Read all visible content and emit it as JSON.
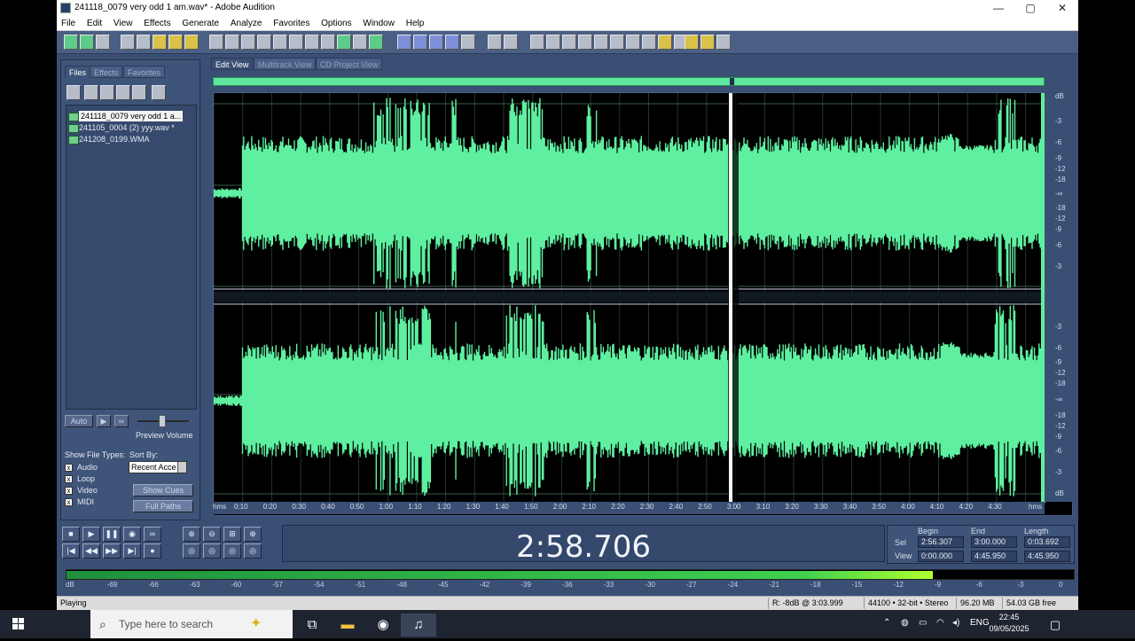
{
  "window": {
    "title": "241118_0079 very odd 1 am.wav* - Adobe Audition",
    "minimize": "—",
    "maximize": "▢",
    "close": "✕"
  },
  "menu": [
    "File",
    "Edit",
    "View",
    "Effects",
    "Generate",
    "Analyze",
    "Favorites",
    "Options",
    "Window",
    "Help"
  ],
  "left_panel": {
    "tabs": [
      "Files",
      "Effects",
      "Favorites"
    ],
    "files": [
      "241118_0079 very odd 1 a...",
      "241105_0004 (2) yyy.wav *",
      "241208_0199.WMA"
    ],
    "auto_label": "Auto",
    "play_label": "▶",
    "loop_label": "∞",
    "preview_volume": "Preview Volume",
    "show_file_types": "Show File Types:",
    "sort_by": "Sort By:",
    "sort_value": "Recent Acce",
    "file_types": [
      "Audio",
      "Loop",
      "Video",
      "MIDI"
    ],
    "show_cues": "Show Cues",
    "full_paths": "Full Paths"
  },
  "view_tabs": [
    "Edit View",
    "Multitrack View",
    "CD Project View"
  ],
  "time_ruler": {
    "label": "hms",
    "ticks": [
      "0:10",
      "0:20",
      "0:30",
      "0:40",
      "0:50",
      "1:00",
      "1:10",
      "1:20",
      "1:30",
      "1:40",
      "1:50",
      "2:00",
      "2:10",
      "2:20",
      "2:30",
      "2:40",
      "2:50",
      "3:00",
      "3:10",
      "3:20",
      "3:30",
      "3:40",
      "3:50",
      "4:00",
      "4:10",
      "4:20",
      "4:30"
    ],
    "end_label": "hms"
  },
  "db_scale": {
    "top": "dB",
    "ch1": [
      "-3",
      "-6",
      "-9",
      "-12",
      "-18",
      "-∞",
      "-18",
      "-12",
      "-9",
      "-6",
      "-3"
    ],
    "ch2": [
      "-3",
      "-6",
      "-9",
      "-12",
      "-18",
      "-∞",
      "-18",
      "-12",
      "-9",
      "-6",
      "-3"
    ],
    "bottom": "dB"
  },
  "transport": {
    "row1": [
      "■",
      "▶",
      "❚❚",
      "◉",
      "∞"
    ],
    "row2": [
      "|◀",
      "◀◀",
      "▶▶",
      "▶|",
      "●"
    ]
  },
  "zoom_buttons": {
    "row1": [
      "⊕",
      "⊖",
      "⊞",
      "⊕"
    ],
    "row2": [
      "◎",
      "◎",
      "◎",
      "◎"
    ]
  },
  "time_display": "2:58.706",
  "selection": {
    "headers": [
      "Begin",
      "End",
      "Length"
    ],
    "sel_label": "Sel",
    "view_label": "View",
    "sel": [
      "2:56.307",
      "3:00.000",
      "0:03.692"
    ],
    "view": [
      "0:00.000",
      "4:45.950",
      "4:45.950"
    ]
  },
  "level_meter": {
    "fill_fraction": 0.86,
    "scale": [
      "dB",
      "-69",
      "-66",
      "-63",
      "-60",
      "-57",
      "-54",
      "-51",
      "-48",
      "-45",
      "-42",
      "-39",
      "-36",
      "-33",
      "-30",
      "-27",
      "-24",
      "-21",
      "-18",
      "-15",
      "-12",
      "-9",
      "-6",
      "-3",
      "0"
    ]
  },
  "status": {
    "state": "Playing",
    "cursor": "R: -8dB @   3:03.999",
    "format": "44100 • 32-bit • Stereo",
    "size": "96.20 MB",
    "free": "54.03 GB free"
  },
  "taskbar": {
    "search_placeholder": "Type here to search",
    "lang": "ENG",
    "time": "22:45",
    "date": "09/05/2025"
  },
  "colors": {
    "waveform": "#5ef0a0",
    "background": "#3a4f74",
    "wave_bg": "#000000"
  }
}
